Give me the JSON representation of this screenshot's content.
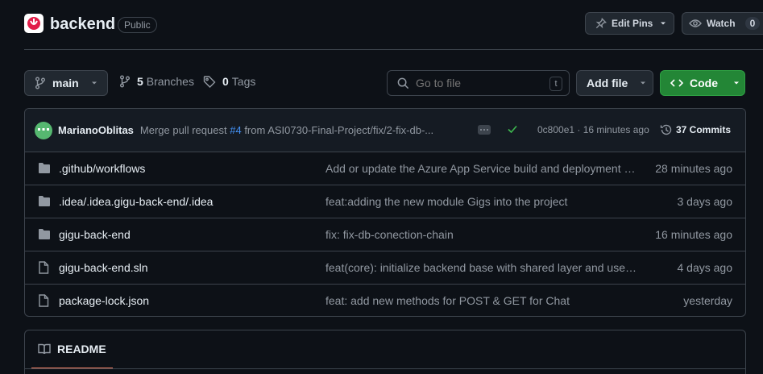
{
  "repo": {
    "name": "backend",
    "visibility": "Public",
    "brand_color": "#e11d48"
  },
  "header_actions": {
    "edit_pins": "Edit Pins",
    "watch": "Watch",
    "watch_count": "0"
  },
  "toolbar": {
    "branch": "main",
    "branches_count": "5",
    "branches_label": "Branches",
    "tags_count": "0",
    "tags_label": "Tags",
    "search_placeholder": "Go to file",
    "search_shortcut": "t",
    "add_file": "Add file",
    "code": "Code"
  },
  "latest_commit": {
    "author": "MarianoOblitas",
    "message_prefix": "Merge pull request",
    "pr": "#4",
    "message_suffix": "from ASI0730-Final-Project/fix/2-fix-db-...",
    "sha_time": "0c800e1 · 16 minutes ago",
    "commits": "37 Commits"
  },
  "files": [
    {
      "icon": "folder-icon",
      "name": ".github/workflows",
      "message": "Add or update the Azure App Service build and deployment workflow config",
      "time": "28 minutes ago"
    },
    {
      "icon": "folder-icon",
      "name": ".idea/.idea.gigu-back-end/.idea",
      "message": "feat:adding the new module Gigs into the project",
      "time": "3 days ago"
    },
    {
      "icon": "folder-icon",
      "name": "gigu-back-end",
      "message": "fix: fix-db-conection-chain",
      "time": "16 minutes ago"
    },
    {
      "icon": "file-icon",
      "name": "gigu-back-end.sln",
      "message": "feat(core): initialize backend base with shared layer and user module",
      "time": "4 days ago"
    },
    {
      "icon": "file-icon",
      "name": "package-lock.json",
      "message": "feat: add new methods for POST & GET for Chat",
      "time": "yesterday"
    }
  ],
  "readme": {
    "tab": "README"
  }
}
